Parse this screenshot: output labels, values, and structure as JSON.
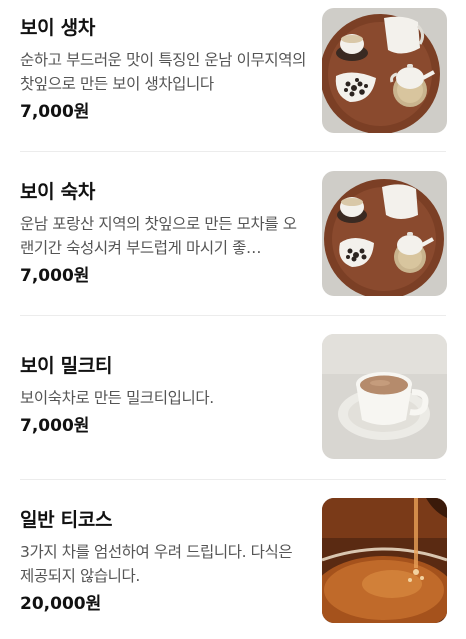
{
  "menu": {
    "items": [
      {
        "name": "보이 생차",
        "description": "순하고 부드러운 맛이 특징인 운남 이무지역의 찻잎으로 만든 보이 생차입니다",
        "price": "7,000원",
        "image": "tea-tray-photo"
      },
      {
        "name": "보이 숙차",
        "description": "운남 포랑산 지역의 찻잎으로 만든 모차를 오랜기간 숙성시켜 부드럽게 마시기 좋…",
        "price": "7,000원",
        "image": "tea-tray-photo"
      },
      {
        "name": "보이 밀크티",
        "description": "보이숙차로 만든 밀크티입니다.",
        "price": "7,000원",
        "image": "milk-tea-cup-photo"
      },
      {
        "name": "일반 티코스",
        "description": "3가지 차를 엄선하여 우려 드립니다. 다식은 제공되지 않습니다.",
        "price": "20,000원",
        "image": "tea-pour-photo"
      }
    ]
  },
  "colors": {
    "tray": "#8a4a2e",
    "teaware": "#f3f1ec",
    "milk_tea": "#b58b6c",
    "brewed_tea": "#a5521c"
  }
}
